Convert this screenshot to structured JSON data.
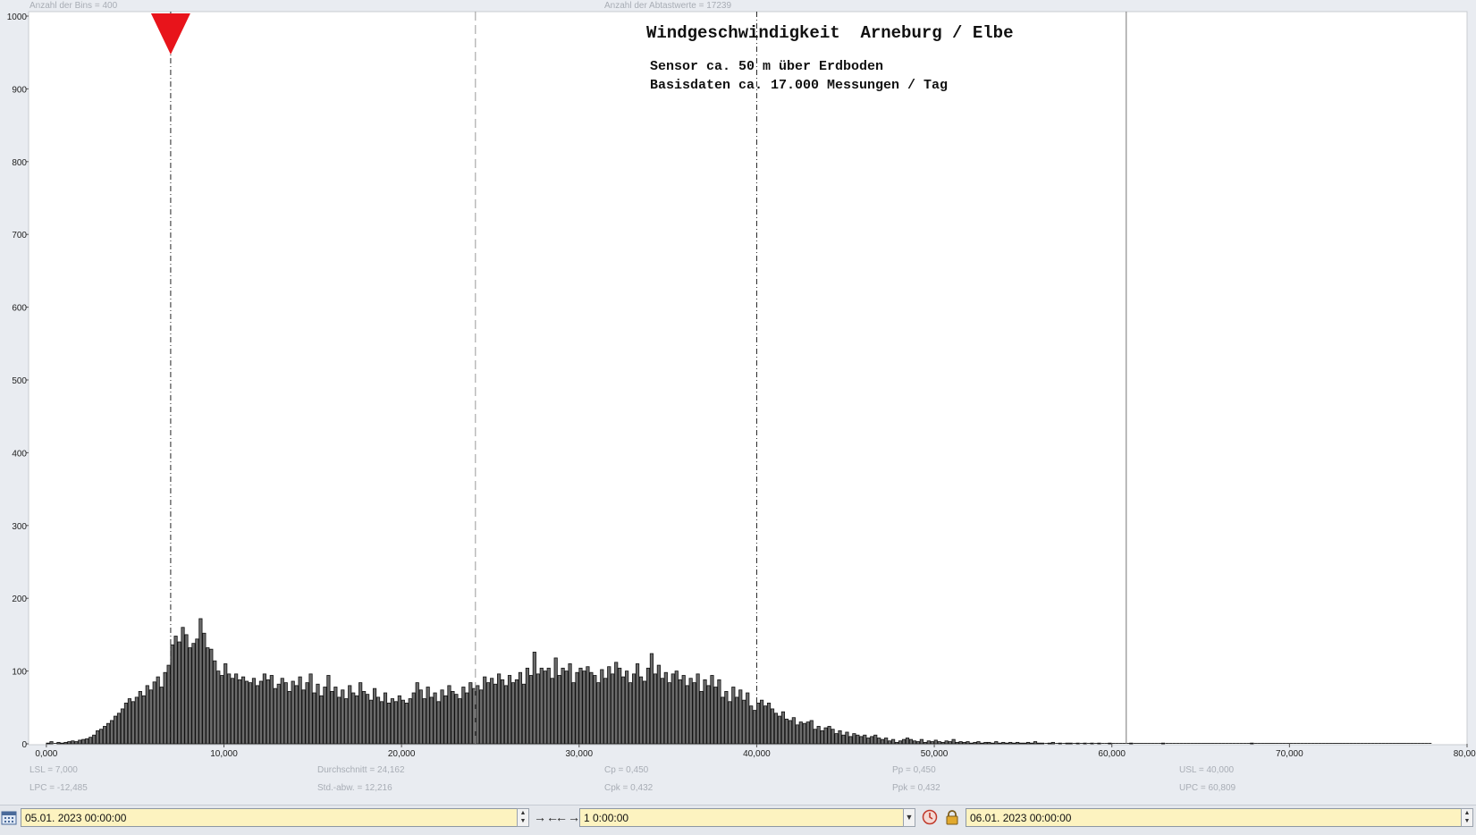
{
  "header": {
    "bins_label": "Anzahl der Bins =",
    "bins_value": "400",
    "samples_label": "Anzahl der Abtastwerte = 17239"
  },
  "chart_data": {
    "type": "bar",
    "title": "Windgeschwindigkeit  Arneburg / Elbe",
    "subtitle_lines": [
      "Sensor ca. 50 m über Erdboden",
      "Basisdaten ca. 17.000 Messungen / Tag"
    ],
    "xlabel": "",
    "ylabel": "",
    "xlim": [
      -1,
      80
    ],
    "ylim": [
      0,
      1000
    ],
    "x_ticks": [
      "0,000",
      "10,000",
      "20,000",
      "30,000",
      "40,000",
      "50,000",
      "60,000",
      "70,000",
      "80,000"
    ],
    "y_ticks": [
      "0",
      "100",
      "200",
      "300",
      "400",
      "500",
      "600",
      "700",
      "800",
      "900",
      "1000"
    ],
    "grid": false,
    "markers": {
      "lsl": 7.0,
      "mean": 24.162,
      "usl": 40.0,
      "upc": 60.809
    },
    "bin_width": 0.2,
    "bins": [
      [
        0.0,
        1
      ],
      [
        0.2,
        3
      ],
      [
        0.4,
        0
      ],
      [
        0.6,
        2
      ],
      [
        0.8,
        1
      ],
      [
        1.0,
        2
      ],
      [
        1.2,
        3
      ],
      [
        1.4,
        4
      ],
      [
        1.6,
        3
      ],
      [
        1.8,
        5
      ],
      [
        2.0,
        6
      ],
      [
        2.2,
        7
      ],
      [
        2.4,
        9
      ],
      [
        2.6,
        12
      ],
      [
        2.8,
        18
      ],
      [
        3.0,
        20
      ],
      [
        3.2,
        24
      ],
      [
        3.4,
        28
      ],
      [
        3.6,
        32
      ],
      [
        3.8,
        38
      ],
      [
        4.0,
        42
      ],
      [
        4.2,
        48
      ],
      [
        4.4,
        56
      ],
      [
        4.6,
        62
      ],
      [
        4.8,
        58
      ],
      [
        5.0,
        64
      ],
      [
        5.2,
        72
      ],
      [
        5.4,
        66
      ],
      [
        5.6,
        80
      ],
      [
        5.8,
        74
      ],
      [
        6.0,
        85
      ],
      [
        6.2,
        92
      ],
      [
        6.4,
        78
      ],
      [
        6.6,
        98
      ],
      [
        6.8,
        108
      ],
      [
        7.0,
        136
      ],
      [
        7.2,
        148
      ],
      [
        7.4,
        140
      ],
      [
        7.6,
        160
      ],
      [
        7.8,
        150
      ],
      [
        8.0,
        132
      ],
      [
        8.2,
        138
      ],
      [
        8.4,
        144
      ],
      [
        8.6,
        172
      ],
      [
        8.8,
        152
      ],
      [
        9.0,
        132
      ],
      [
        9.2,
        130
      ],
      [
        9.4,
        114
      ],
      [
        9.6,
        100
      ],
      [
        9.8,
        94
      ],
      [
        10.0,
        110
      ],
      [
        10.2,
        96
      ],
      [
        10.4,
        90
      ],
      [
        10.6,
        96
      ],
      [
        10.8,
        88
      ],
      [
        11.0,
        92
      ],
      [
        11.2,
        86
      ],
      [
        11.4,
        84
      ],
      [
        11.6,
        90
      ],
      [
        11.8,
        80
      ],
      [
        12.0,
        86
      ],
      [
        12.2,
        96
      ],
      [
        12.4,
        88
      ],
      [
        12.6,
        94
      ],
      [
        12.8,
        76
      ],
      [
        13.0,
        82
      ],
      [
        13.2,
        90
      ],
      [
        13.4,
        84
      ],
      [
        13.6,
        72
      ],
      [
        13.8,
        86
      ],
      [
        14.0,
        80
      ],
      [
        14.2,
        92
      ],
      [
        14.4,
        74
      ],
      [
        14.6,
        84
      ],
      [
        14.8,
        96
      ],
      [
        15.0,
        70
      ],
      [
        15.2,
        82
      ],
      [
        15.4,
        66
      ],
      [
        15.6,
        78
      ],
      [
        15.8,
        94
      ],
      [
        16.0,
        72
      ],
      [
        16.2,
        78
      ],
      [
        16.4,
        64
      ],
      [
        16.6,
        74
      ],
      [
        16.8,
        62
      ],
      [
        17.0,
        80
      ],
      [
        17.2,
        70
      ],
      [
        17.4,
        66
      ],
      [
        17.6,
        84
      ],
      [
        17.8,
        72
      ],
      [
        18.0,
        68
      ],
      [
        18.2,
        60
      ],
      [
        18.4,
        76
      ],
      [
        18.6,
        64
      ],
      [
        18.8,
        58
      ],
      [
        19.0,
        70
      ],
      [
        19.2,
        56
      ],
      [
        19.4,
        62
      ],
      [
        19.6,
        58
      ],
      [
        19.8,
        66
      ],
      [
        20.0,
        60
      ],
      [
        20.2,
        56
      ],
      [
        20.4,
        62
      ],
      [
        20.6,
        70
      ],
      [
        20.8,
        84
      ],
      [
        21.0,
        74
      ],
      [
        21.2,
        62
      ],
      [
        21.4,
        78
      ],
      [
        21.6,
        64
      ],
      [
        21.8,
        70
      ],
      [
        22.0,
        58
      ],
      [
        22.2,
        74
      ],
      [
        22.4,
        66
      ],
      [
        22.6,
        80
      ],
      [
        22.8,
        72
      ],
      [
        23.0,
        68
      ],
      [
        23.2,
        62
      ],
      [
        23.4,
        78
      ],
      [
        23.6,
        70
      ],
      [
        23.8,
        84
      ],
      [
        24.0,
        76
      ],
      [
        24.2,
        80
      ],
      [
        24.4,
        74
      ],
      [
        24.6,
        92
      ],
      [
        24.8,
        84
      ],
      [
        25.0,
        90
      ],
      [
        25.2,
        82
      ],
      [
        25.4,
        96
      ],
      [
        25.6,
        88
      ],
      [
        25.8,
        80
      ],
      [
        26.0,
        94
      ],
      [
        26.2,
        84
      ],
      [
        26.4,
        88
      ],
      [
        26.6,
        98
      ],
      [
        26.8,
        82
      ],
      [
        27.0,
        104
      ],
      [
        27.2,
        94
      ],
      [
        27.4,
        126
      ],
      [
        27.6,
        96
      ],
      [
        27.8,
        104
      ],
      [
        28.0,
        100
      ],
      [
        28.2,
        104
      ],
      [
        28.4,
        90
      ],
      [
        28.6,
        118
      ],
      [
        28.8,
        94
      ],
      [
        29.0,
        104
      ],
      [
        29.2,
        100
      ],
      [
        29.4,
        110
      ],
      [
        29.6,
        84
      ],
      [
        29.8,
        98
      ],
      [
        30.0,
        104
      ],
      [
        30.2,
        100
      ],
      [
        30.4,
        106
      ],
      [
        30.6,
        98
      ],
      [
        30.8,
        94
      ],
      [
        31.0,
        84
      ],
      [
        31.2,
        102
      ],
      [
        31.4,
        90
      ],
      [
        31.6,
        106
      ],
      [
        31.8,
        96
      ],
      [
        32.0,
        112
      ],
      [
        32.2,
        104
      ],
      [
        32.4,
        92
      ],
      [
        32.6,
        100
      ],
      [
        32.8,
        84
      ],
      [
        33.0,
        96
      ],
      [
        33.2,
        110
      ],
      [
        33.4,
        92
      ],
      [
        33.6,
        86
      ],
      [
        33.8,
        104
      ],
      [
        34.0,
        124
      ],
      [
        34.2,
        96
      ],
      [
        34.4,
        108
      ],
      [
        34.6,
        90
      ],
      [
        34.8,
        98
      ],
      [
        35.0,
        84
      ],
      [
        35.2,
        96
      ],
      [
        35.4,
        100
      ],
      [
        35.6,
        88
      ],
      [
        35.8,
        94
      ],
      [
        36.0,
        80
      ],
      [
        36.2,
        90
      ],
      [
        36.4,
        84
      ],
      [
        36.6,
        96
      ],
      [
        36.8,
        72
      ],
      [
        37.0,
        88
      ],
      [
        37.2,
        80
      ],
      [
        37.4,
        94
      ],
      [
        37.6,
        78
      ],
      [
        37.8,
        88
      ],
      [
        38.0,
        64
      ],
      [
        38.2,
        72
      ],
      [
        38.4,
        58
      ],
      [
        38.6,
        78
      ],
      [
        38.8,
        64
      ],
      [
        39.0,
        74
      ],
      [
        39.2,
        60
      ],
      [
        39.4,
        70
      ],
      [
        39.6,
        52
      ],
      [
        39.8,
        46
      ],
      [
        40.0,
        56
      ],
      [
        40.2,
        60
      ],
      [
        40.4,
        52
      ],
      [
        40.6,
        56
      ],
      [
        40.8,
        48
      ],
      [
        41.0,
        42
      ],
      [
        41.2,
        38
      ],
      [
        41.4,
        44
      ],
      [
        41.6,
        34
      ],
      [
        41.8,
        32
      ],
      [
        42.0,
        36
      ],
      [
        42.2,
        26
      ],
      [
        42.4,
        30
      ],
      [
        42.6,
        28
      ],
      [
        42.8,
        30
      ],
      [
        43.0,
        32
      ],
      [
        43.2,
        20
      ],
      [
        43.4,
        24
      ],
      [
        43.6,
        18
      ],
      [
        43.8,
        22
      ],
      [
        44.0,
        24
      ],
      [
        44.2,
        20
      ],
      [
        44.4,
        14
      ],
      [
        44.6,
        18
      ],
      [
        44.8,
        12
      ],
      [
        45.0,
        16
      ],
      [
        45.2,
        10
      ],
      [
        45.4,
        14
      ],
      [
        45.6,
        12
      ],
      [
        45.8,
        10
      ],
      [
        46.0,
        12
      ],
      [
        46.2,
        8
      ],
      [
        46.4,
        10
      ],
      [
        46.6,
        12
      ],
      [
        46.8,
        8
      ],
      [
        47.0,
        6
      ],
      [
        47.2,
        8
      ],
      [
        47.4,
        4
      ],
      [
        47.6,
        6
      ],
      [
        47.8,
        2
      ],
      [
        48.0,
        4
      ],
      [
        48.2,
        6
      ],
      [
        48.4,
        8
      ],
      [
        48.6,
        6
      ],
      [
        48.8,
        4
      ],
      [
        49.0,
        3
      ],
      [
        49.2,
        6
      ],
      [
        49.4,
        2
      ],
      [
        49.6,
        4
      ],
      [
        49.8,
        3
      ],
      [
        50.0,
        5
      ],
      [
        50.2,
        3
      ],
      [
        50.4,
        2
      ],
      [
        50.6,
        4
      ],
      [
        50.8,
        3
      ],
      [
        51.0,
        6
      ],
      [
        51.2,
        2
      ],
      [
        51.4,
        3
      ],
      [
        51.6,
        2
      ],
      [
        51.8,
        3
      ],
      [
        52.0,
        1
      ],
      [
        52.2,
        2
      ],
      [
        52.4,
        3
      ],
      [
        52.6,
        1
      ],
      [
        52.8,
        2
      ],
      [
        53.0,
        2
      ],
      [
        53.2,
        1
      ],
      [
        53.4,
        3
      ],
      [
        53.6,
        1
      ],
      [
        53.8,
        2
      ],
      [
        54.0,
        1
      ],
      [
        54.2,
        2
      ],
      [
        54.4,
        1
      ],
      [
        54.6,
        2
      ],
      [
        54.8,
        1
      ],
      [
        55.0,
        1
      ],
      [
        55.2,
        2
      ],
      [
        55.4,
        1
      ],
      [
        55.6,
        3
      ],
      [
        55.8,
        1
      ],
      [
        56.0,
        1
      ],
      [
        56.2,
        0
      ],
      [
        56.4,
        1
      ],
      [
        56.6,
        2
      ],
      [
        56.8,
        0
      ],
      [
        57.0,
        1
      ],
      [
        57.2,
        0
      ],
      [
        57.4,
        1
      ],
      [
        57.6,
        1
      ],
      [
        57.8,
        0
      ],
      [
        58.0,
        1
      ],
      [
        58.2,
        0
      ],
      [
        58.4,
        1
      ],
      [
        58.6,
        0
      ],
      [
        58.8,
        1
      ],
      [
        59.0,
        0
      ],
      [
        59.2,
        1
      ],
      [
        59.4,
        0
      ],
      [
        59.6,
        0
      ],
      [
        59.8,
        1
      ],
      [
        60.0,
        0
      ],
      [
        60.2,
        0
      ],
      [
        60.4,
        0
      ],
      [
        60.6,
        0
      ],
      [
        60.8,
        0
      ],
      [
        61.0,
        1
      ],
      [
        61.2,
        0
      ],
      [
        61.4,
        0
      ],
      [
        61.6,
        0
      ],
      [
        61.8,
        0
      ],
      [
        62.0,
        0
      ],
      [
        62.2,
        0
      ],
      [
        62.4,
        0
      ],
      [
        62.6,
        0
      ],
      [
        62.8,
        1
      ],
      [
        63.0,
        0
      ],
      [
        63.2,
        0
      ],
      [
        63.4,
        0
      ],
      [
        63.6,
        0
      ],
      [
        63.8,
        0
      ],
      [
        64.0,
        0
      ],
      [
        64.2,
        0
      ],
      [
        64.4,
        0
      ],
      [
        64.6,
        0
      ],
      [
        64.8,
        0
      ],
      [
        65.0,
        0
      ],
      [
        65.2,
        0
      ],
      [
        65.4,
        0
      ],
      [
        65.6,
        0
      ],
      [
        65.8,
        0
      ],
      [
        66.0,
        0
      ],
      [
        66.2,
        0
      ],
      [
        66.4,
        0
      ],
      [
        66.6,
        0
      ],
      [
        66.8,
        0
      ],
      [
        67.0,
        0
      ],
      [
        67.2,
        0
      ],
      [
        67.4,
        0
      ],
      [
        67.6,
        0
      ],
      [
        67.8,
        1
      ],
      [
        68.0,
        0
      ],
      [
        68.2,
        0
      ],
      [
        68.4,
        0
      ],
      [
        68.6,
        0
      ],
      [
        68.8,
        0
      ],
      [
        69.0,
        0
      ],
      [
        69.2,
        0
      ],
      [
        69.4,
        0
      ],
      [
        69.6,
        0
      ],
      [
        69.8,
        0
      ],
      [
        70.0,
        0
      ],
      [
        70.2,
        0
      ],
      [
        70.4,
        0
      ],
      [
        70.6,
        0
      ],
      [
        70.8,
        0
      ],
      [
        71.0,
        0
      ],
      [
        71.2,
        0
      ],
      [
        71.4,
        0
      ],
      [
        71.6,
        0
      ],
      [
        71.8,
        0
      ],
      [
        72.0,
        0
      ],
      [
        72.2,
        0
      ],
      [
        72.4,
        0
      ],
      [
        72.6,
        0
      ],
      [
        72.8,
        0
      ],
      [
        73.0,
        0
      ],
      [
        73.2,
        0
      ],
      [
        73.4,
        0
      ],
      [
        73.6,
        0
      ],
      [
        73.8,
        0
      ],
      [
        74.0,
        0
      ],
      [
        74.2,
        0
      ],
      [
        74.4,
        0
      ],
      [
        74.6,
        0
      ],
      [
        74.8,
        0
      ],
      [
        75.0,
        0
      ],
      [
        75.2,
        0
      ],
      [
        75.4,
        0
      ],
      [
        75.6,
        0
      ],
      [
        75.8,
        0
      ],
      [
        76.0,
        0
      ],
      [
        76.2,
        0
      ],
      [
        76.4,
        0
      ],
      [
        76.6,
        0
      ],
      [
        76.8,
        0
      ],
      [
        77.0,
        0
      ],
      [
        77.2,
        0
      ],
      [
        77.4,
        0
      ],
      [
        77.6,
        0
      ],
      [
        77.8,
        0
      ]
    ],
    "colors": {
      "bar_fill": "#6b6b6b",
      "bar_edge": "#111111",
      "marker": "#e8141b",
      "plot_bg": "#ffffff"
    }
  },
  "stats": {
    "lsl": "LSL = 7,000",
    "lpc": "LPC = -12,485",
    "mean": "Durchschnitt  = 24,162",
    "stdabw": "Std.-abw. = 12,216",
    "cp": "Cp  = 0,450",
    "cpk": "Cpk = 0,432",
    "pp": "Pp  = 0,450",
    "ppk": "Ppk = 0,432",
    "usl": "USL = 40,000",
    "upc": "UPC = 60,809"
  },
  "toolbar": {
    "start_datetime": "05.01. 2023   00:00:00",
    "interval": "1 0:00:00",
    "end_datetime": "06.01. 2023   00:00:00",
    "zoom_in_label": "→←",
    "zoom_out_label": "←→"
  }
}
